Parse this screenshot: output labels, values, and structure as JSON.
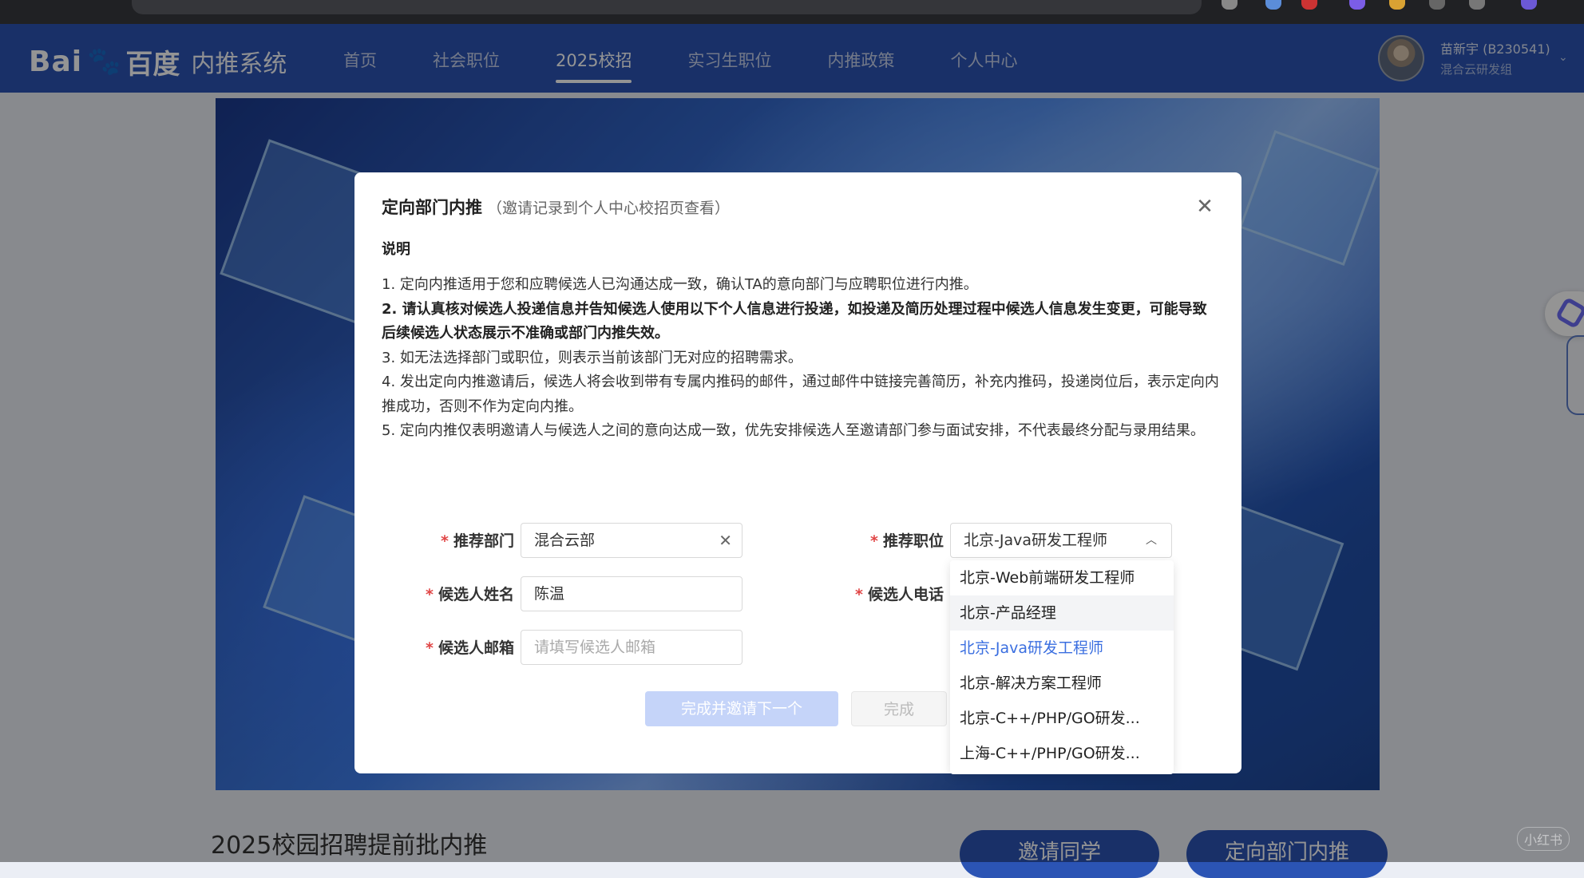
{
  "header": {
    "logo_text": "Bai",
    "logo_cn": "百度",
    "logo_sub": "内推系统",
    "nav": [
      {
        "label": "首页"
      },
      {
        "label": "社会职位"
      },
      {
        "label": "2025校招",
        "active": true
      },
      {
        "label": "实习生职位"
      },
      {
        "label": "内推政策"
      },
      {
        "label": "个人中心"
      }
    ],
    "user_name": "苗新宇 (B230541)",
    "user_dept": "混合云研发组"
  },
  "modal": {
    "title": "定向部门内推",
    "title_note": "（邀请记录到个人中心校招页查看）",
    "desc_head": "说明",
    "desc": [
      {
        "text": "1. 定向内推适用于您和应聘候选人已沟通达成一致，确认TA的意向部门与应聘职位进行内推。",
        "bold": false
      },
      {
        "text": "2. 请认真核对候选人投递信息并告知候选人使用以下个人信息进行投递，如投递及简历处理过程中候选人信息发生变更，可能导致后续候选人状态展示不准确或部门内推失效。",
        "bold": true
      },
      {
        "text": "3. 如无法选择部门或职位，则表示当前该部门无对应的招聘需求。",
        "bold": false
      },
      {
        "text": "4. 发出定向内推邀请后，候选人将会收到带有专属内推码的邮件，通过邮件中链接完善简历，补充内推码，投递岗位后，表示定向内推成功，否则不作为定向内推。",
        "bold": false
      },
      {
        "text": "5. 定向内推仅表明邀请人与候选人之间的意向达成一致，优先安排候选人至邀请部门参与面试安排，不代表最终分配与录用结果。",
        "bold": false
      }
    ],
    "form": {
      "dept_label": "推荐部门",
      "dept_value": "混合云部",
      "position_label": "推荐职位",
      "position_value": "北京-Java研发工程师",
      "name_label": "候选人姓名",
      "name_value": "陈温",
      "phone_label": "候选人电话",
      "email_label": "候选人邮箱",
      "email_placeholder": "请填写候选人邮箱"
    },
    "buttons": {
      "invite_next": "完成并邀请下一个",
      "finish": "完成"
    },
    "dropdown_options": [
      "北京-Web前端研发工程师",
      "北京-产品经理",
      "北京-Java研发工程师",
      "北京-解决方案工程师",
      "北京-C++/PHP/GO研发...",
      "上海-C++/PHP/GO研发..."
    ]
  },
  "page": {
    "bottom_title": "2025校园招聘提前批内推",
    "invite_classmate": "邀请同学",
    "directed_referral": "定向部门内推",
    "watermark": "小红书"
  }
}
